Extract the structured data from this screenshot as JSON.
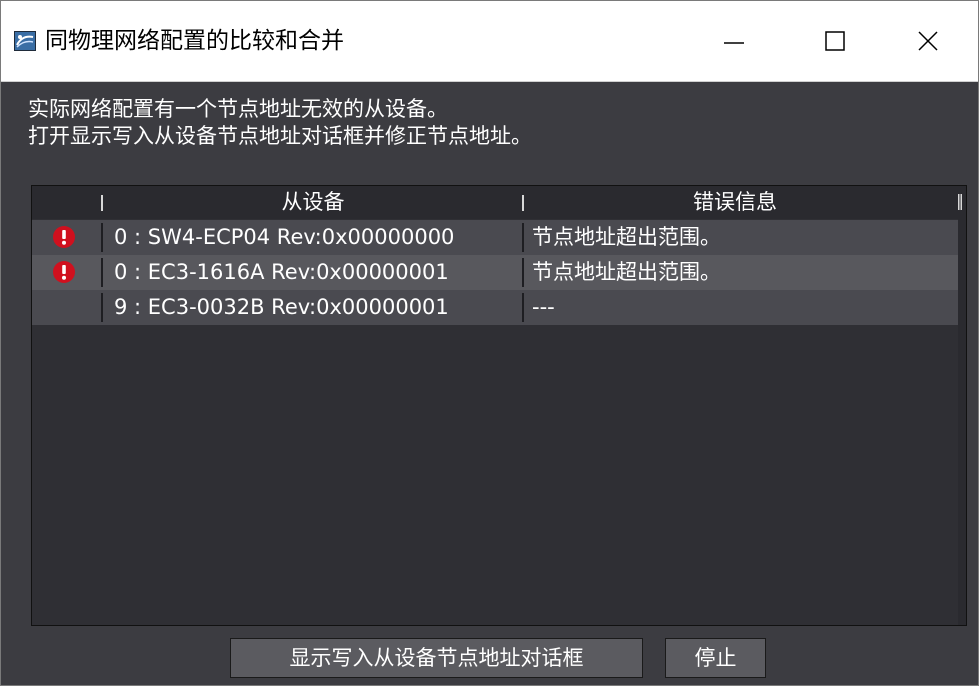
{
  "window": {
    "title": "同物理网络配置的比较和合并",
    "icon": "network-app-icon",
    "controls": [
      "minimize-icon",
      "maximize-icon",
      "close-icon"
    ]
  },
  "messages": {
    "line1": "实际网络配置有一个节点地址无效的从设备。",
    "line2": "打开显示写入从设备节点地址对话框并修正节点地址。"
  },
  "grid": {
    "columns": {
      "device": "从设备",
      "error": "错误信息"
    },
    "rows": [
      {
        "status_icon": "error-icon",
        "device": "0 : SW4-ECP04 Rev:0x00000000",
        "error": "节点地址超出范围。"
      },
      {
        "status_icon": "error-icon",
        "device": "0 : EC3-1616A Rev:0x00000001",
        "error": "节点地址超出范围。"
      },
      {
        "status_icon": "",
        "device": "9 : EC3-0032B Rev:0x00000001",
        "error": "---"
      }
    ]
  },
  "buttons": {
    "show_write_dialog": "显示写入从设备节点地址对话框",
    "stop": "停止"
  },
  "colors": {
    "background": "#3c3c41",
    "error_icon": "#d0101e",
    "titlebar": "#ffffff"
  }
}
